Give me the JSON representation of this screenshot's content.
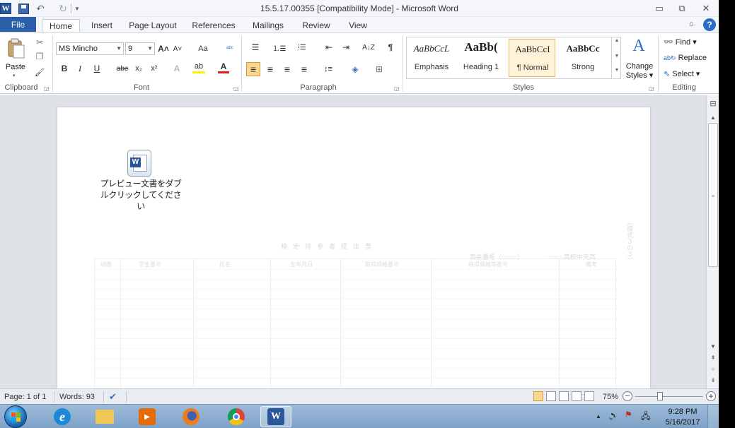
{
  "window": {
    "title": "15.5.17.00355 [Compatibility Mode] - Microsoft Word",
    "app_icon_letter": "W",
    "min_glyph": "▭",
    "max_glyph": "⧉",
    "close_glyph": "✕"
  },
  "quick_access": {
    "undo_glyph": "↶",
    "redo_glyph": "↻",
    "more_glyph": "▾"
  },
  "tabs": {
    "file": "File",
    "home": "Home",
    "insert": "Insert",
    "page_layout": "Page Layout",
    "references": "References",
    "mailings": "Mailings",
    "review": "Review",
    "view": "View",
    "collapse_glyph": "⌂",
    "help_glyph": "?"
  },
  "ribbon": {
    "clipboard": {
      "label": "Clipboard",
      "paste": "Paste",
      "cut_glyph": "✂",
      "copy_glyph": "❐",
      "format_painter_glyph": "🖌"
    },
    "font": {
      "label": "Font",
      "font_name": "MS Mincho",
      "font_size": "9",
      "grow": "A˄",
      "shrink": "A˅",
      "change_case": "Aa",
      "clear_format": "ᵃᵇᶜ",
      "bold": "B",
      "italic": "I",
      "underline": "U",
      "strike": "abe",
      "subscript": "x₂",
      "superscript": "x²",
      "text_effects": "A",
      "highlight": "ab",
      "font_color": "A"
    },
    "paragraph": {
      "label": "Paragraph",
      "bullets": "☰",
      "numbering": "⒈☰",
      "multilevel": "⁞☰",
      "decrease_indent": "⇤",
      "increase_indent": "⇥",
      "sort": "A↓Z",
      "show_marks": "¶",
      "align_left": "≡",
      "center": "≡",
      "align_right": "≡",
      "justify": "≡",
      "line_spacing": "↕≡",
      "shading": "◈",
      "borders": "⊞"
    },
    "styles": {
      "label": "Styles",
      "items": [
        {
          "sample": "AaBbCcL",
          "name": "Emphasis"
        },
        {
          "sample": "AaBb(",
          "name": "Heading 1"
        },
        {
          "sample": "AaBbCcI",
          "name": "¶ Normal"
        },
        {
          "sample": "AaBbCc",
          "name": "Strong"
        }
      ],
      "change_styles_line1": "Change",
      "change_styles_line2": "Styles ▾"
    },
    "editing": {
      "label": "Editing",
      "find": "Find ▾",
      "replace": "Replace",
      "select": "Select ▾"
    }
  },
  "document": {
    "preview_caption_line1": "プレビュー文書をダブ",
    "preview_caption_line2": "ルクリックしてください",
    "faint_title": "検定持参書提出票",
    "faint_right1": "高会番号（○○○○）",
    "faint_right2": "○○○○高校中央高",
    "faint_vertical": "（様式３の３）",
    "faint_headers": [
      "項番",
      "学生番号",
      "氏名",
      "生年月日",
      "取得資格番号",
      "取得資格等番号",
      "備考"
    ]
  },
  "statusbar": {
    "page": "Page: 1 of 1",
    "words": "Words: 93",
    "zoom": "75%",
    "zoom_out": "−",
    "zoom_in": "+"
  },
  "taskbar": {
    "time": "9:28 PM",
    "date": "5/16/2017"
  },
  "colors": {
    "file_tab": "#2a5ea8",
    "word_blue": "#2b579a",
    "selected_style": "#fef3d8",
    "active_align": "#f7d792",
    "taskbar": "#8fb1d3"
  }
}
